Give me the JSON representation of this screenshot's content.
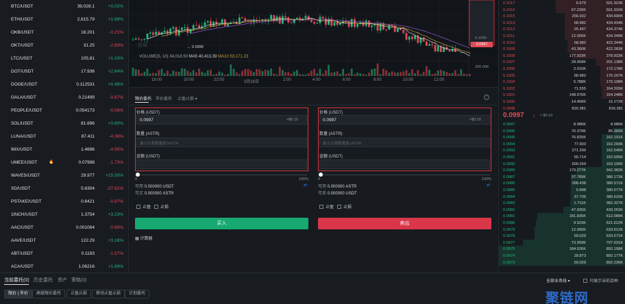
{
  "market_list": [
    {
      "symbol": "BTC/USDT",
      "price": "39,028.1",
      "change": "+0.02%",
      "dir": "up"
    },
    {
      "symbol": "ETH/USDT",
      "price": "2,615.79",
      "change": "+1.69%",
      "dir": "up"
    },
    {
      "symbol": "OKB/USDT",
      "price": "18.201",
      "change": "-0.21%",
      "dir": "down"
    },
    {
      "symbol": "OKT/USDT",
      "price": "31.25",
      "change": "-2.83%",
      "dir": "down"
    },
    {
      "symbol": "LTC/USDT",
      "price": "105.81",
      "change": "+1.03%",
      "dir": "up"
    },
    {
      "symbol": "DOT/USDT",
      "price": "17.936",
      "change": "+2.64%",
      "dir": "up"
    },
    {
      "symbol": "DOGE/USDT",
      "price": "0.112531",
      "change": "+0.48%",
      "dir": "up"
    },
    {
      "symbol": "GALA/USDT",
      "price": "0.21499",
      "change": "-0.67%",
      "dir": "down"
    },
    {
      "symbol": "PEOPLE/USDT",
      "price": "0.054173",
      "change": "-0.06%",
      "dir": "down"
    },
    {
      "symbol": "SOL/USDT",
      "price": "81.696",
      "change": "+0.80%",
      "dir": "up"
    },
    {
      "symbol": "LUNA/USDT",
      "price": "87.411",
      "change": "-4.36%",
      "dir": "down"
    },
    {
      "symbol": "IMX/USDT",
      "price": "1.4696",
      "change": "-4.95%",
      "dir": "down"
    },
    {
      "symbol": "UMEE/USDT",
      "price": "0.07998",
      "change": "-1.73%",
      "dir": "down",
      "hot": true
    },
    {
      "symbol": "WAVES/USDT",
      "price": "29.977",
      "change": "+15.50%",
      "dir": "up"
    },
    {
      "symbol": "SD/USDT",
      "price": "5.6304",
      "change": "-27.81%",
      "dir": "down"
    },
    {
      "symbol": "PSTAKE/USDT",
      "price": "0.6421",
      "change": "-0.97%",
      "dir": "down"
    },
    {
      "symbol": "1INCH/USDT",
      "price": "1.3754",
      "change": "+3.23%",
      "dir": "up"
    },
    {
      "symbol": "AAC/USDT",
      "price": "0.001064",
      "change": "-0.65%",
      "dir": "down"
    },
    {
      "symbol": "AAVE/USDT",
      "price": "122.29",
      "change": "+3.16%",
      "dir": "up"
    },
    {
      "symbol": "ABT/USDT",
      "price": "0.1193",
      "change": "-1.57%",
      "dir": "down"
    },
    {
      "symbol": "ACA/USDT",
      "price": "1.06216",
      "change": "+1.69%",
      "dir": "up"
    }
  ],
  "hot_icon": "fire-icon",
  "chart": {
    "volume_info": {
      "label": "VOLUME(5, 10)",
      "vol": "34,018.50",
      "ma5_label": "MA5",
      "ma5": "40,413.39",
      "ma10_label": "MA10",
      "ma10": "53,171.23"
    },
    "time_labels": [
      "18:00",
      "20:00",
      "22:00",
      "3月18日",
      "2:00",
      "4:00",
      "6:00",
      "8:00",
      "10:00",
      "12:00"
    ],
    "price_labels": [
      "0.1000"
    ],
    "volume_axis_label": "200.00K",
    "last_price": "0.0997",
    "low_marker": "← 0.0995",
    "watermark": "欧易"
  },
  "trade": {
    "tabs": [
      "限价委托",
      "市价委托",
      "止盈止损"
    ],
    "tab_dropdown_icon": "chevron-down-icon",
    "help_icon": "help-circle-icon",
    "buy": {
      "price_label": "价格 (USDT)",
      "price_value": "0.0997",
      "price_est": "≈$0.10",
      "qty_label": "数量 (ASTR)",
      "qty_placeholder": "最小交易数量是1ASTR",
      "amount_label": "金额 (USDT)",
      "pct_min": "0",
      "pct_max": "100%",
      "available_label": "可用",
      "available_value": "0.000000 USDT",
      "can_buy_label": "可买",
      "can_buy_value": "0.000000 ASTR",
      "tp_label": "止盈",
      "sl_label": "止损",
      "button": "买入"
    },
    "sell": {
      "price_label": "价格 (USDT)",
      "price_value": "0.0997",
      "price_est": "≈$0.10",
      "qty_label": "数量 (ASTR)",
      "qty_placeholder": "最小交易数量是1ASTR",
      "amount_label": "金额 (USDT)",
      "pct_min": "0",
      "pct_max": "100%",
      "available_label": "可用",
      "available_value": "0.000000 ASTR",
      "can_sell_label": "可卖",
      "can_sell_value": "0.000000 USDT",
      "tp_label": "止盈",
      "sl_label": "止损",
      "button": "卖出"
    },
    "transfer_icon": "transfer-icon",
    "calculator_icon": "calculator-icon",
    "calculator_label": "计算器"
  },
  "order_book": {
    "asks": [
      {
        "price": "0.1017",
        "qty": "6.679",
        "total": "501.923K",
        "depth": 0.55
      },
      {
        "price": "0.1016",
        "qty": "67.226K",
        "total": "501.916K",
        "depth": 0.55
      },
      {
        "price": "0.1015",
        "qty": "256.932",
        "total": "434.690K",
        "depth": 0.48
      },
      {
        "price": "0.1013",
        "qty": "58.982",
        "total": "434.434K",
        "depth": 0.48
      },
      {
        "price": "0.1012",
        "qty": "25.497",
        "total": "434.374K",
        "depth": 0.48
      },
      {
        "price": "0.1011",
        "qty": "12.005K",
        "total": "434.349K",
        "depth": 0.48
      },
      {
        "price": "0.1010",
        "qty": "58.982",
        "total": "422.344K",
        "depth": 0.46
      },
      {
        "price": "0.1009",
        "qty": "43.360K",
        "total": "422.283K",
        "depth": 0.46
      },
      {
        "price": "0.1008",
        "qty": "177.923K",
        "total": "378.923K",
        "depth": 0.42
      },
      {
        "price": "0.1007",
        "qty": "28.959K",
        "total": "201.138K",
        "depth": 0.23
      },
      {
        "price": "0.1006",
        "qty": "2.010K",
        "total": "172.178K",
        "depth": 0.2
      },
      {
        "price": "0.1005",
        "qty": "58.982",
        "total": "170.167K",
        "depth": 0.2
      },
      {
        "price": "0.1004",
        "qty": "5.788K",
        "total": "170.108K",
        "depth": 0.2
      },
      {
        "price": "0.1002",
        "qty": "71.555",
        "total": "164.320K",
        "depth": 0.19
      },
      {
        "price": "0.1001",
        "qty": "148.976K",
        "total": "164.248K",
        "depth": 0.19
      },
      {
        "price": "0.1000",
        "qty": "14.456K",
        "total": "15.272K",
        "depth": 0.03
      },
      {
        "price": "0.0998",
        "qty": "816.381",
        "total": "816.381",
        "depth": 0.01
      }
    ],
    "mid_price": "0.0997",
    "mid_arrow_icon": "arrow-down-icon",
    "mid_usd": "≈ $0.10",
    "bids": [
      {
        "price": "0.0997",
        "qty": "8.986K",
        "total": "8.986K",
        "depth": 0.01
      },
      {
        "price": "0.0996",
        "qty": "76.379K",
        "total": "85.366K",
        "depth": 0.1
      },
      {
        "price": "0.0995",
        "qty": "76.825K",
        "total": "162.191K",
        "depth": 0.19
      },
      {
        "price": "0.0994",
        "qty": "77.903",
        "total": "162.269K",
        "depth": 0.19
      },
      {
        "price": "0.0993",
        "qty": "271.200",
        "total": "162.540K",
        "depth": 0.19
      },
      {
        "price": "0.0991",
        "qty": "65.714",
        "total": "162.605K",
        "depth": 0.19
      },
      {
        "price": "0.0990",
        "qty": "500.269",
        "total": "163.106K",
        "depth": 0.19
      },
      {
        "price": "0.0989",
        "qty": "179.277K",
        "total": "342.383K",
        "depth": 0.39
      },
      {
        "price": "0.0987",
        "qty": "37.789K",
        "total": "380.173K",
        "depth": 0.43
      },
      {
        "price": "0.0986",
        "qty": "398.438",
        "total": "380.571K",
        "depth": 0.43
      },
      {
        "price": "0.0985",
        "qty": "5.898",
        "total": "380.577K",
        "depth": 0.43
      },
      {
        "price": "0.0984",
        "qty": "37.706",
        "total": "380.615K",
        "depth": 0.43
      },
      {
        "price": "0.0983",
        "qty": "1.711K",
        "total": "382.327K",
        "depth": 0.44
      },
      {
        "price": "0.0982",
        "qty": "47.926K",
        "total": "430.253K",
        "depth": 0.49
      },
      {
        "price": "0.0981",
        "qty": "181.835K",
        "total": "612.089K",
        "depth": 0.7
      },
      {
        "price": "0.0980",
        "qty": "9.523K",
        "total": "621.612K",
        "depth": 0.71
      },
      {
        "price": "0.0979",
        "qty": "12.000K",
        "total": "633.612K",
        "depth": 0.72
      },
      {
        "price": "0.0978",
        "qty": "59.029",
        "total": "633.671K",
        "depth": 0.72
      },
      {
        "price": "0.0977",
        "qty": "73.959K",
        "total": "707.631K",
        "depth": 0.81
      },
      {
        "price": "0.0975",
        "qty": "184.526K",
        "total": "892.158K",
        "depth": 1.0
      },
      {
        "price": "0.0974",
        "qty": "18.873",
        "total": "892.177K",
        "depth": 1.0
      },
      {
        "price": "0.0973",
        "qty": "59.029",
        "total": "892.236K",
        "depth": 1.0
      }
    ]
  },
  "bottom": {
    "tabs": [
      "当前委托(0)",
      "历史委托",
      "资产",
      "策略(0)"
    ],
    "chips": [
      "限价 | 市价",
      "高级限价委托",
      "止盈止损",
      "移动止盈止损",
      "计划委托"
    ],
    "all_pairs": "全部业务线 ▾",
    "only_current": "只展示当前品种",
    "brand": "聚链网"
  },
  "colors": {
    "up": "#23b97c",
    "down": "#e34a55",
    "highlight_box": "#d9363e",
    "buy_button": "#18a871",
    "sell_button": "#d9364a"
  }
}
